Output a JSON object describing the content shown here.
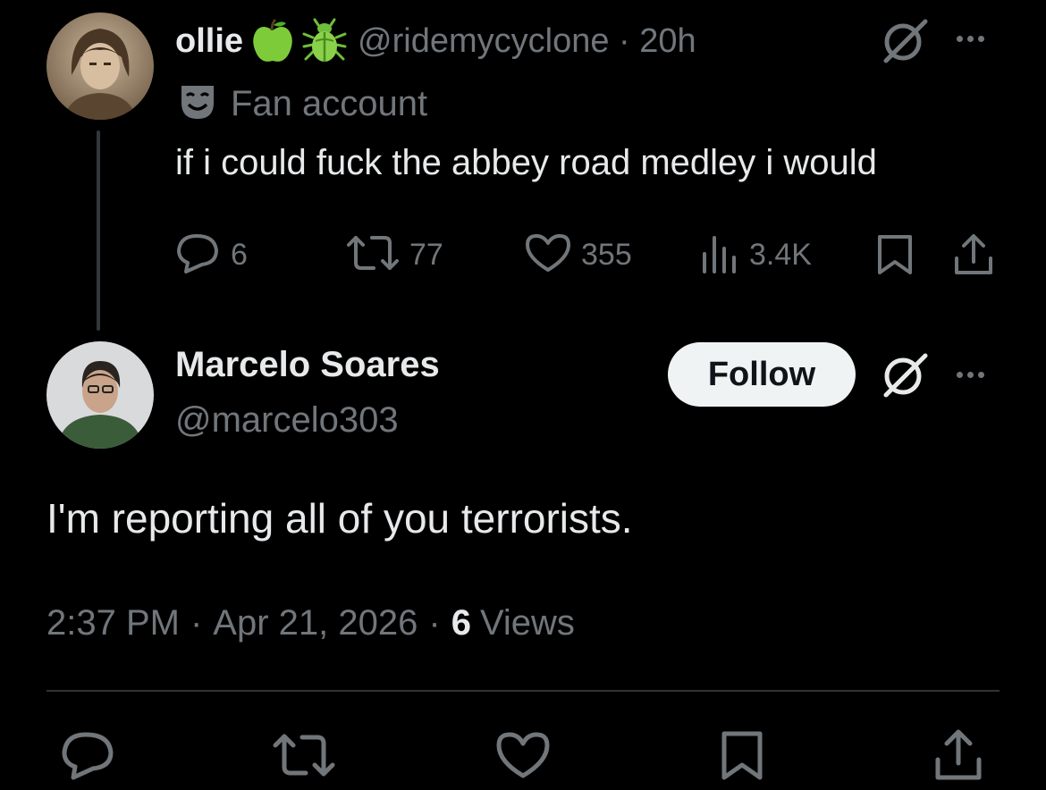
{
  "parent_tweet": {
    "display_name": "ollie",
    "emojis": [
      "green-apple-icon",
      "beetle-icon"
    ],
    "handle": "@ridemycyclone",
    "separator": "·",
    "time": "20h",
    "account_label": "Fan account",
    "text": "if i could fuck the abbey road medley i would",
    "stats": {
      "replies": "6",
      "reposts": "77",
      "likes": "355",
      "views": "3.4K"
    }
  },
  "reply": {
    "display_name": "Marcelo Soares",
    "handle": "@marcelo303",
    "follow_label": "Follow",
    "text": "I'm reporting all of you terrorists.",
    "time": "2:37 PM",
    "separator": "·",
    "date": "Apr 21, 2026",
    "views_count": "6",
    "views_label": "Views"
  },
  "colors": {
    "background": "#000000",
    "text_primary": "#e7e9ea",
    "text_secondary": "#71767b",
    "follow_bg": "#eff3f4",
    "divider": "#2f3336"
  }
}
